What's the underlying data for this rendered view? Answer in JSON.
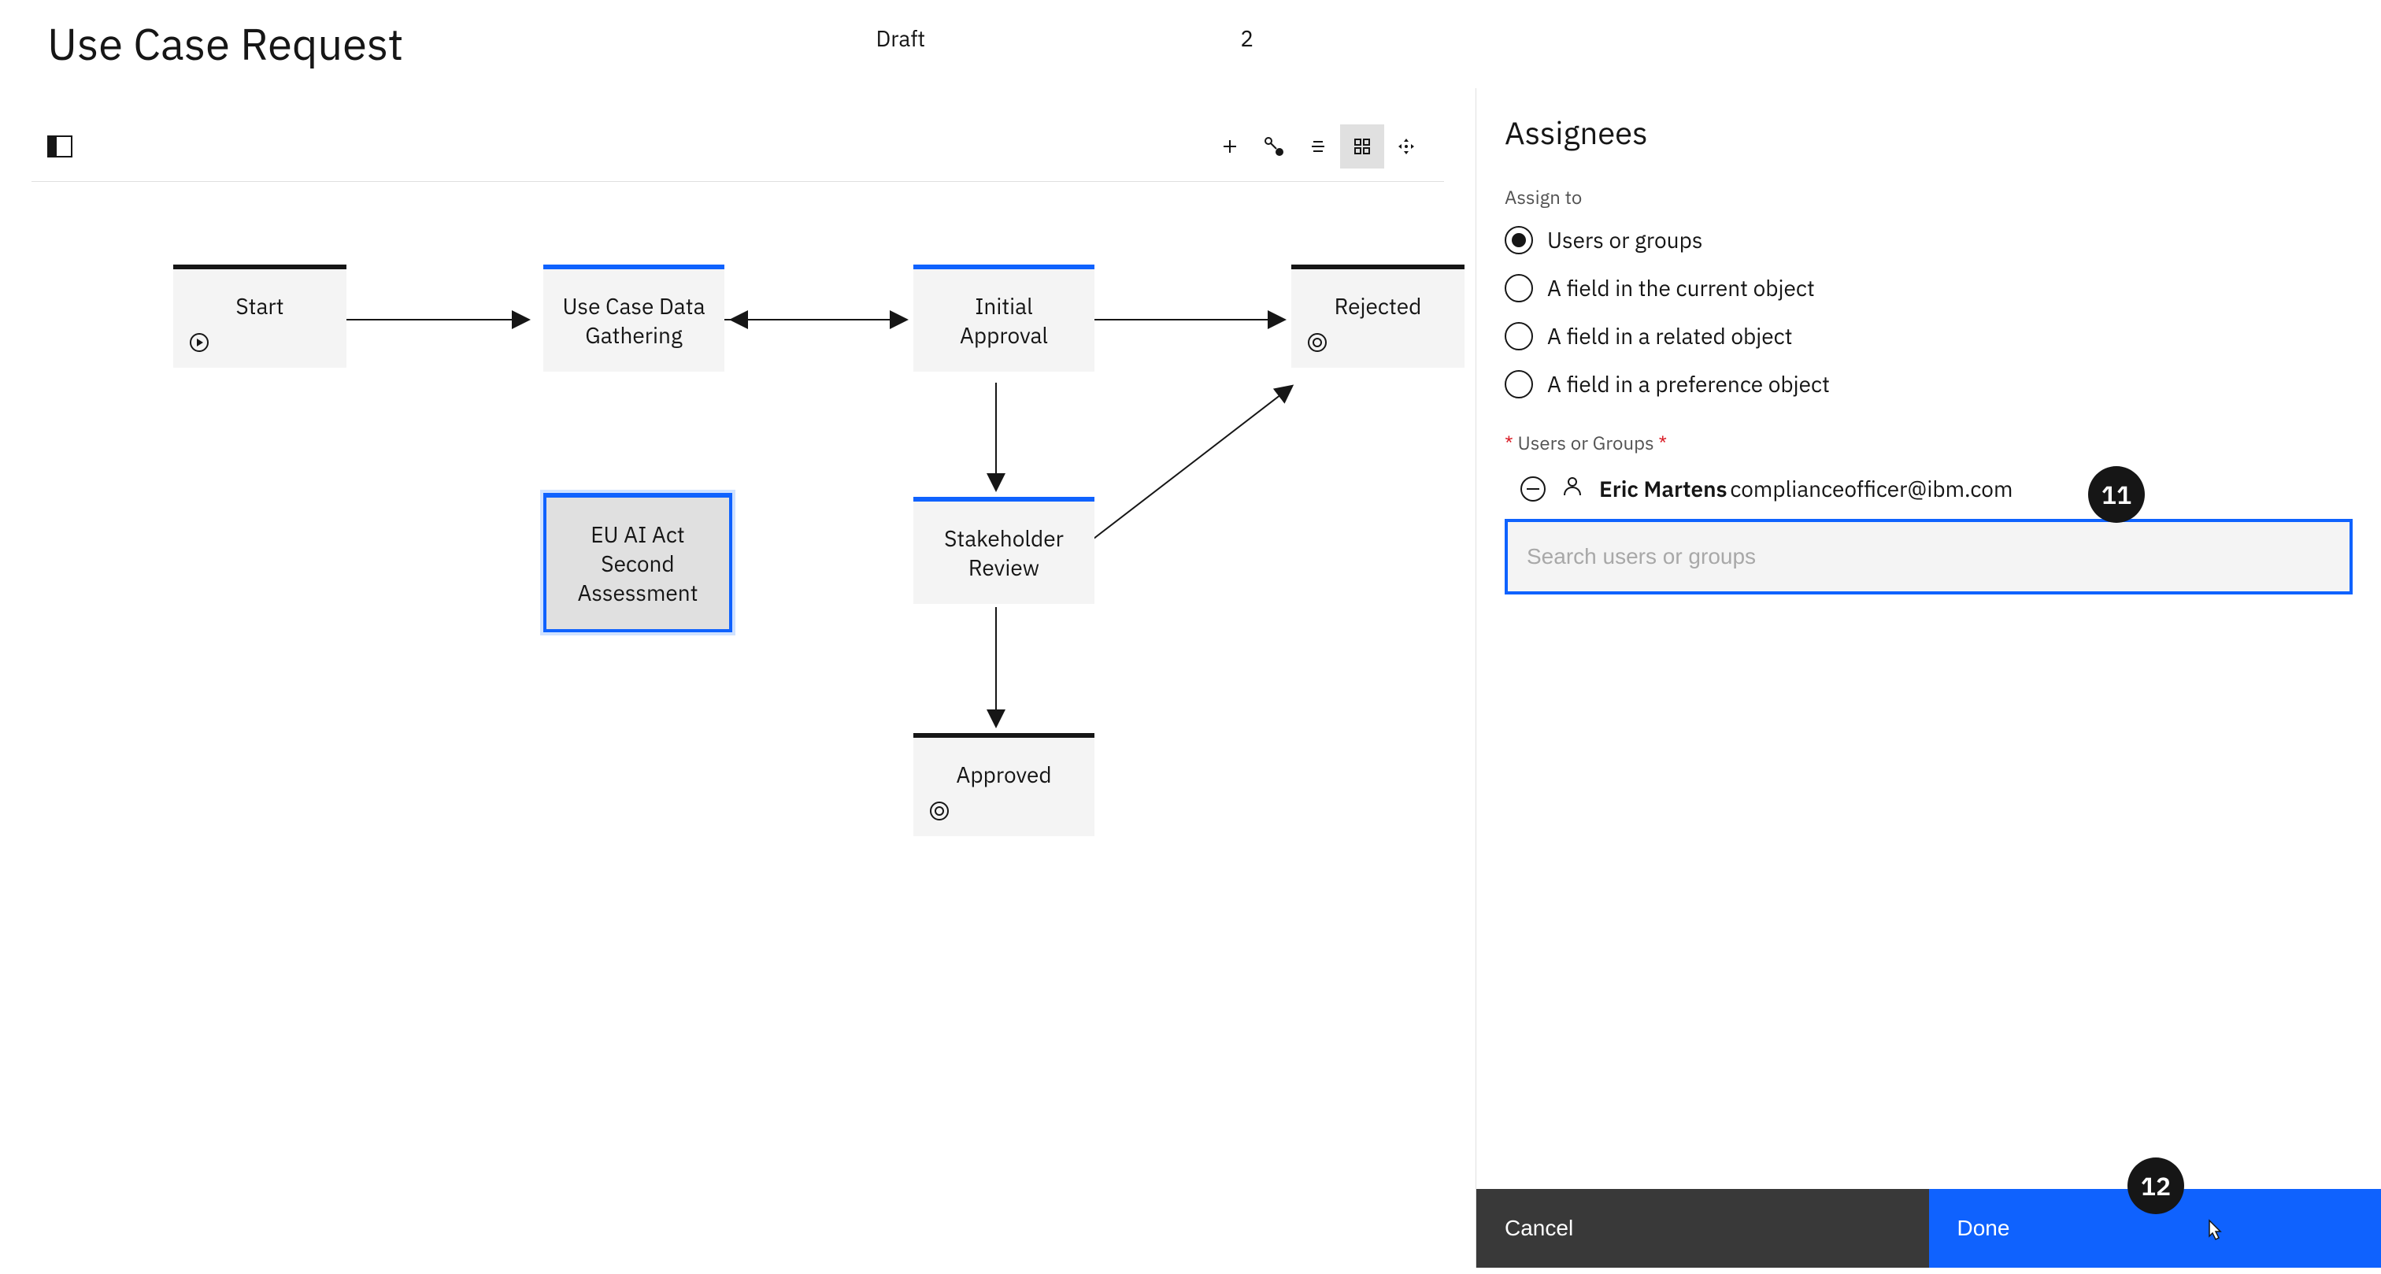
{
  "header": {
    "title": "Use Case Request",
    "status": "Draft",
    "count": "2"
  },
  "nodes": {
    "start": "Start",
    "gathering": "Use Case Data Gathering",
    "initial": "Initial Approval",
    "rejected": "Rejected",
    "euai": "EU AI Act Second Assessment",
    "stakeholder": "Stakeholder Review",
    "approved": "Approved"
  },
  "sidebar": {
    "title": "Assignees",
    "assign_to_label": "Assign to",
    "radio_options": [
      "Users or groups",
      "A field in the current object",
      "A field in a related object",
      "A field in a preference object"
    ],
    "users_label_prefix": "*",
    "users_label": " Users or Groups ",
    "users_label_suffix": "*",
    "user": {
      "name": "Eric Martens",
      "email": "complianceofficer@ibm.com"
    },
    "search_placeholder": "Search users or groups",
    "cancel": "Cancel",
    "done": "Done"
  },
  "callouts": {
    "eleven": "11",
    "twelve": "12"
  }
}
